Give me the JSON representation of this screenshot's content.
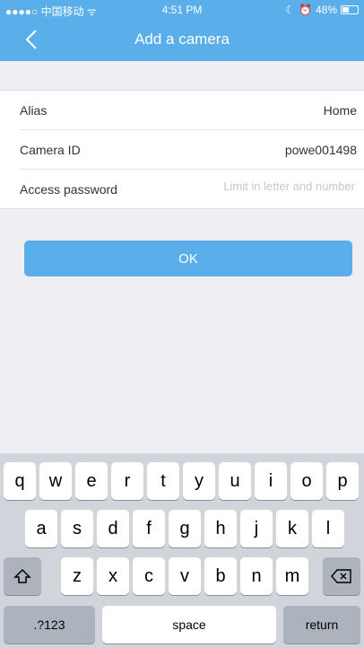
{
  "status_bar": {
    "carrier": "●●●●○ 中国移动 ᯤ",
    "time": "4:51 PM",
    "battery": "48%"
  },
  "header": {
    "title": "Add a camera"
  },
  "form": {
    "alias_label": "Alias",
    "alias_value": "Home",
    "camera_id_label": "Camera ID",
    "camera_id_value": "powe001498",
    "password_label": "Access password",
    "password_placeholder": "Limit in letter and number"
  },
  "ok_button": "OK",
  "keyboard": {
    "row1": [
      "q",
      "w",
      "e",
      "r",
      "t",
      "y",
      "u",
      "i",
      "o",
      "p"
    ],
    "row2": [
      "a",
      "s",
      "d",
      "f",
      "g",
      "h",
      "j",
      "k",
      "l"
    ],
    "row3": [
      "z",
      "x",
      "c",
      "v",
      "b",
      "n",
      "m"
    ],
    "numbers_key": ".?123",
    "space_key": "space",
    "return_key": "return",
    "shift_icon": "shift-icon",
    "delete_icon": "delete-icon"
  }
}
